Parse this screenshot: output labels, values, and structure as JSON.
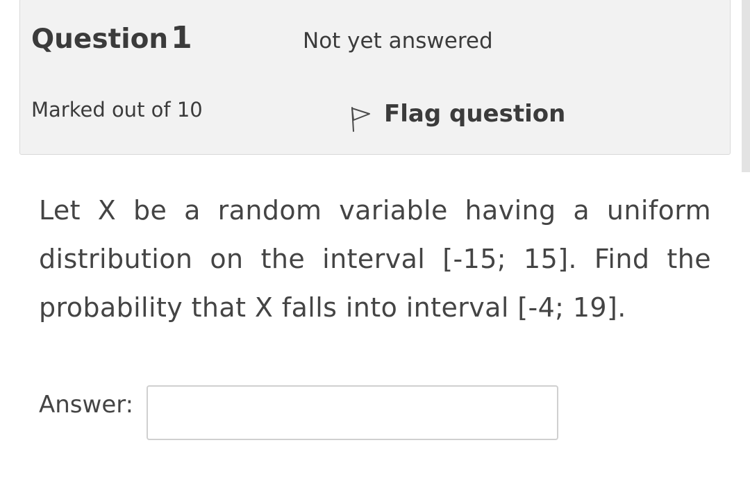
{
  "question": {
    "title_prefix": "Question",
    "number": "1",
    "state": "Not yet answered",
    "grade": "Marked out of 10",
    "flag_label": "Flag question"
  },
  "content": {
    "text": "Let X be a random variable having a uniform distribution on the interval [-15; 15]. Find the probability that X falls into interval [-4; 19]."
  },
  "answer": {
    "label": "Answer:",
    "value": ""
  },
  "icons": {
    "flag": "flag-icon"
  }
}
